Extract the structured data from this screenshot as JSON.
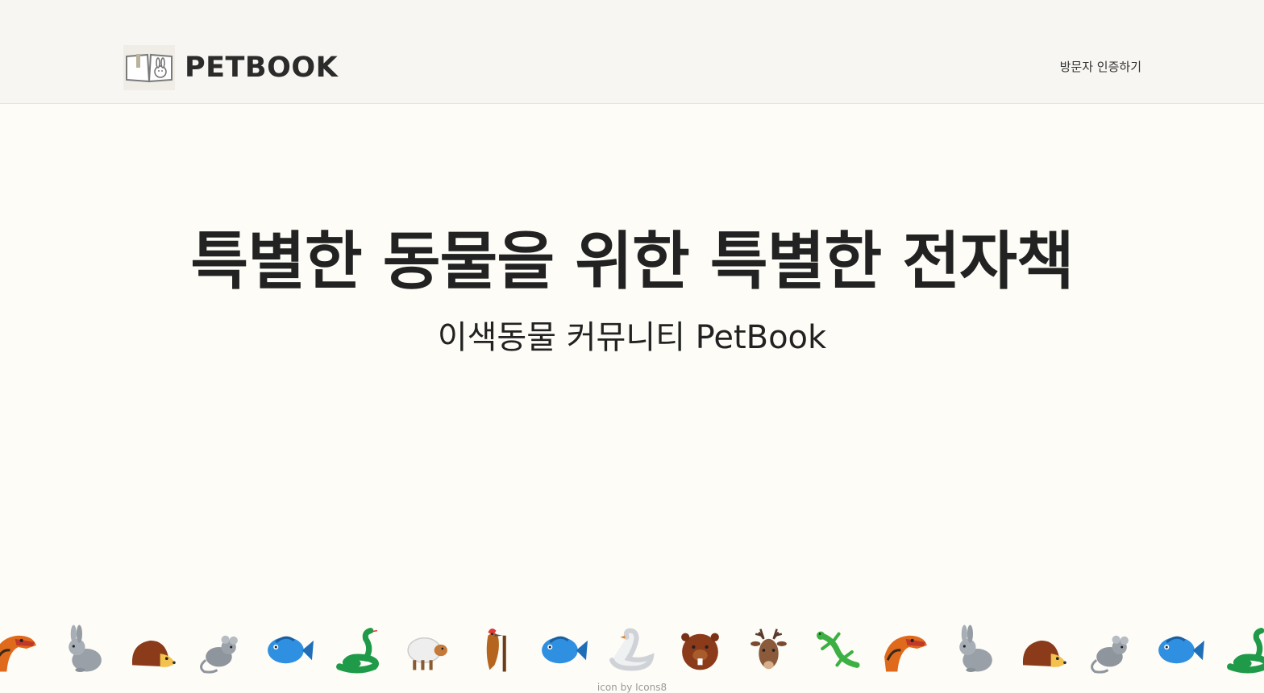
{
  "header": {
    "logo_text": "PETBOOK",
    "nav_link": "방문자 인증하기"
  },
  "hero": {
    "title": "특별한 동물을 위한 특별한 전자책",
    "subtitle": "이색동물 커뮤니티 PetBook"
  },
  "animals": [
    {
      "icon": "dinosaur-icon"
    },
    {
      "icon": "rabbit-icon"
    },
    {
      "icon": "hedgehog-icon"
    },
    {
      "icon": "mouse-icon"
    },
    {
      "icon": "fish-icon"
    },
    {
      "icon": "snake-icon"
    },
    {
      "icon": "sheep-icon"
    },
    {
      "icon": "woodpecker-icon"
    },
    {
      "icon": "fish-icon"
    },
    {
      "icon": "swan-icon"
    },
    {
      "icon": "beaver-icon"
    },
    {
      "icon": "deer-icon"
    },
    {
      "icon": "lizard-icon"
    },
    {
      "icon": "dinosaur-icon"
    },
    {
      "icon": "rabbit-icon"
    },
    {
      "icon": "hedgehog-icon"
    },
    {
      "icon": "mouse-icon"
    },
    {
      "icon": "fish-icon"
    },
    {
      "icon": "snake-icon"
    }
  ],
  "footer": {
    "credit": "icon by Icons8"
  },
  "colors": {
    "header_bg": "#f7f6f2",
    "page_bg": "#fdfcf7",
    "text": "#222222"
  }
}
